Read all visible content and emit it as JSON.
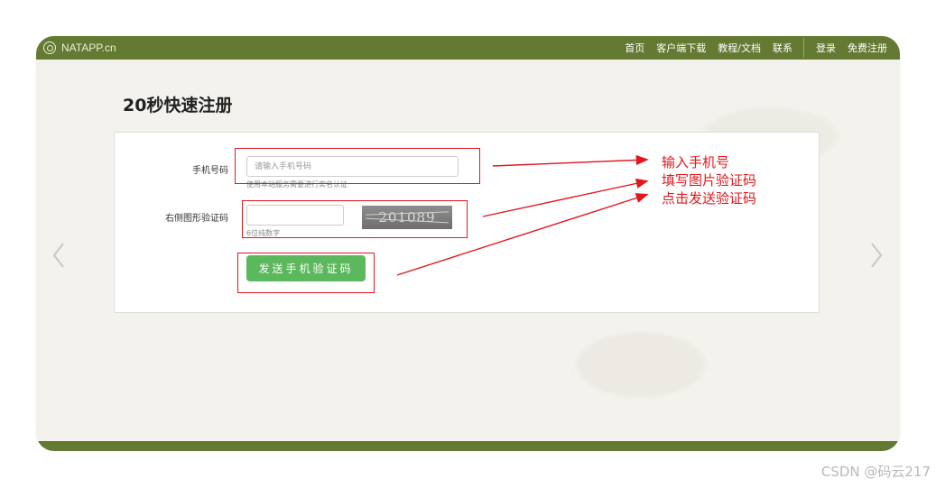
{
  "navbar": {
    "brand": "NATAPP.cn",
    "links": [
      "首页",
      "客户端下载",
      "教程/文档",
      "联系"
    ],
    "login": "登录",
    "register": "免费注册"
  },
  "page": {
    "title": "20秒快速注册"
  },
  "form": {
    "phone_label": "手机号码",
    "phone_placeholder": "请输入手机号码",
    "phone_value": "",
    "phone_help": "使用本站服务需要进行实名认证",
    "captcha_label": "右侧图形验证码",
    "captcha_value": "",
    "captcha_help": "6位纯数字",
    "captcha_image_text": "201089",
    "send_button": "发送手机验证码"
  },
  "annotation": {
    "lines": [
      "输入手机号",
      "填写图片验证码",
      "点击发送验证码"
    ]
  },
  "colors": {
    "navbar": "#647a33",
    "button": "#5cb85c",
    "annotation": "#e0181d",
    "background": "#f3f2ed"
  },
  "icons": {
    "brand": "natapp-logo-icon",
    "prev": "chevron-left-icon",
    "next": "chevron-right-icon"
  },
  "watermark": "CSDN @码云217"
}
